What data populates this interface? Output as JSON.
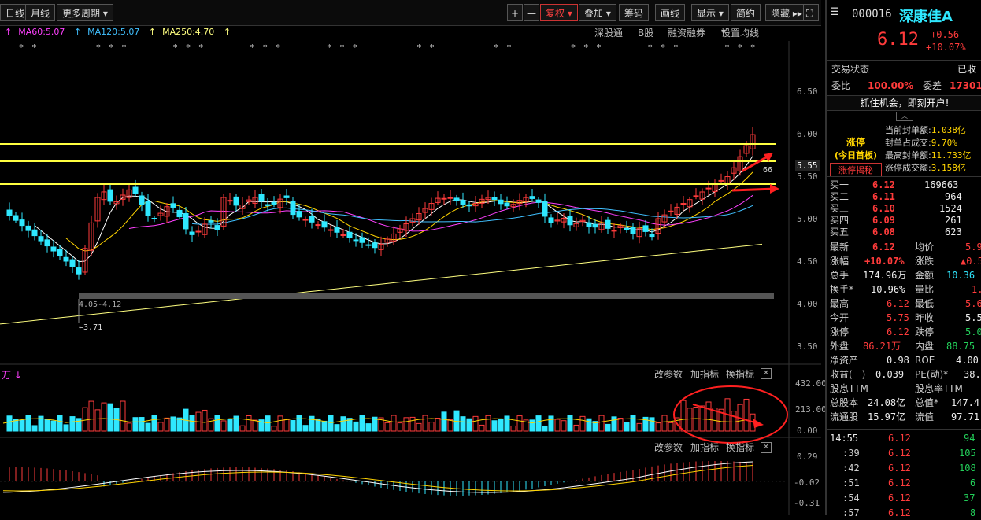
{
  "toolbar": {
    "left_buttons": [
      "日线",
      "月线",
      "更多周期"
    ],
    "right_buttons": [
      {
        "label": "+",
        "active": false
      },
      {
        "label": "—",
        "active": false
      },
      {
        "label": "复权",
        "active": true
      },
      {
        "label": "叠加",
        "active": false
      },
      {
        "label": "筹码",
        "active": false
      },
      {
        "label": "画线",
        "active": false
      },
      {
        "label": "显示",
        "active": false
      },
      {
        "label": "简约",
        "active": false
      },
      {
        "label": "隐藏",
        "active": false
      }
    ]
  },
  "ma_legend": [
    {
      "text": "MA60:5.07",
      "color": "#ff40ff"
    },
    {
      "text": "MA120:5.07",
      "color": "#40c0ff"
    },
    {
      "text": "MA250:4.70",
      "color": "#ffff80"
    }
  ],
  "chart_menu": [
    "深股通",
    "B股",
    "融资融券",
    "设置均线"
  ],
  "price_axis": [
    "6.50",
    "6.00",
    "5.55",
    "5.50",
    "5.00",
    "4.50",
    "4.00",
    "3.50"
  ],
  "annotations": {
    "low_range": "4.05-4.12",
    "low_value": "3.71",
    "label_566": "66"
  },
  "volume_panel": {
    "label": "万",
    "buttons": [
      "改参数",
      "加指标",
      "换指标"
    ],
    "axis": [
      "432.00",
      "213.00",
      "0.00"
    ]
  },
  "macd_panel": {
    "buttons": [
      "改参数",
      "加指标",
      "换指标"
    ],
    "axis": [
      "0.29",
      "-0.02",
      "-0.31"
    ]
  },
  "stock": {
    "code": "000016",
    "name": "深康佳A",
    "price": "6.12",
    "change": "+0.56",
    "change_pct": "+10.07%",
    "status_label": "交易状态",
    "status_value": "已收",
    "webi_label": "委比",
    "webi_value": "100.00%",
    "weicha_label": "委差",
    "weicha_value": "17301",
    "banner": "抓住机会，即刻开户!"
  },
  "limit_up": {
    "title": "涨停",
    "subtitle": "(今日首板)",
    "link": "涨停揭秘",
    "items": [
      {
        "label": "当前封单额:",
        "value": "1.038亿"
      },
      {
        "label": "封单占成交:",
        "value": "9.70%"
      },
      {
        "label": "最高封单额:",
        "value": "11.733亿"
      },
      {
        "label": "涨停成交额:",
        "value": "3.158亿"
      }
    ]
  },
  "order_book": [
    {
      "label": "买一",
      "price": "6.12",
      "volume": "169663"
    },
    {
      "label": "买二",
      "price": "6.11",
      "volume": "964"
    },
    {
      "label": "买三",
      "price": "6.10",
      "volume": "1524"
    },
    {
      "label": "买四",
      "price": "6.09",
      "volume": "261"
    },
    {
      "label": "买五",
      "price": "6.08",
      "volume": "623"
    }
  ],
  "stats": [
    {
      "l1": "最新",
      "v1": "6.12",
      "c1": "red",
      "l2": "均价",
      "v2": "5.9",
      "c2": "red"
    },
    {
      "l1": "涨幅",
      "v1": "+10.07%",
      "c1": "red",
      "l2": "涨跌",
      "v2": "▲0.5",
      "c2": "red"
    },
    {
      "l1": "总手",
      "v1": "174.96万",
      "c1": "white",
      "l2": "金额",
      "v2": "10.36",
      "c2": "cyan"
    },
    {
      "l1": "换手*",
      "v1": "10.96%",
      "c1": "white",
      "l2": "量比",
      "v2": "1.",
      "c2": "red"
    },
    {
      "l1": "最高",
      "v1": "6.12",
      "c1": "red",
      "l2": "最低",
      "v2": "5.6",
      "c2": "red"
    },
    {
      "l1": "今开",
      "v1": "5.75",
      "c1": "red",
      "l2": "昨收",
      "v2": "5.5",
      "c2": "white"
    },
    {
      "l1": "涨停",
      "v1": "6.12",
      "c1": "red",
      "l2": "跌停",
      "v2": "5.0",
      "c2": "green"
    },
    {
      "l1": "外盘",
      "v1": "86.21万",
      "c1": "red",
      "l2": "内盘",
      "v2": "88.75",
      "c2": "green"
    },
    {
      "l1": "净资产",
      "v1": "0.98",
      "c1": "white",
      "l2": "ROE",
      "v2": "4.00",
      "c2": "white"
    },
    {
      "l1": "收益(一)",
      "v1": "0.039",
      "c1": "white",
      "l2": "PE(动)*",
      "v2": "38.",
      "c2": "white"
    },
    {
      "l1": "股息TTM",
      "v1": "—",
      "c1": "white",
      "l2": "股息率TTM",
      "v2": "—",
      "c2": "white"
    },
    {
      "l1": "总股本",
      "v1": "24.08亿",
      "c1": "white",
      "l2": "总值*",
      "v2": "147.4",
      "c2": "white"
    },
    {
      "l1": "流通股",
      "v1": "15.97亿",
      "c1": "white",
      "l2": "流值",
      "v2": "97.71",
      "c2": "white"
    }
  ],
  "ticks": [
    {
      "time": "14:55",
      "price": "6.12",
      "volume": "94"
    },
    {
      "time": ":39",
      "price": "6.12",
      "volume": "105"
    },
    {
      "time": ":42",
      "price": "6.12",
      "volume": "108"
    },
    {
      "time": ":51",
      "price": "6.12",
      "volume": "6"
    },
    {
      "time": ":54",
      "price": "6.12",
      "volume": "37"
    },
    {
      "time": ":57",
      "price": "6.12",
      "volume": "8"
    }
  ]
}
